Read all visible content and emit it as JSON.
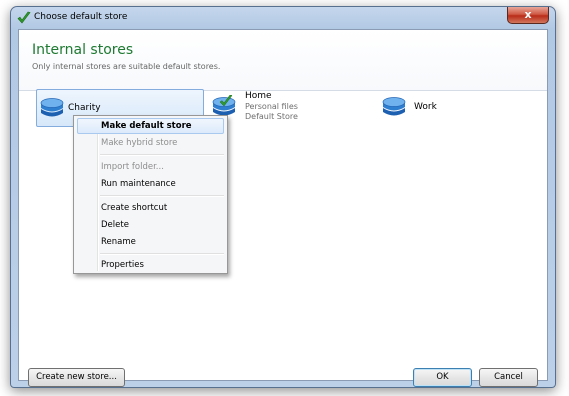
{
  "window": {
    "title": "Choose default store",
    "close_label": "x"
  },
  "header": {
    "title": "Internal stores",
    "subtitle": "Only internal stores are suitable default stores."
  },
  "stores": [
    {
      "name": "Charity",
      "lines": []
    },
    {
      "name": "Home",
      "lines": [
        "Personal files",
        "Default Store"
      ]
    },
    {
      "name": "Work",
      "lines": []
    }
  ],
  "context_menu": {
    "items": [
      {
        "label": "Make default store",
        "state": "highlighted-bold"
      },
      {
        "label": "Make hybrid store",
        "state": "disabled"
      },
      {
        "label": "Import folder...",
        "state": "disabled"
      },
      {
        "label": "Run maintenance",
        "state": "enabled"
      },
      {
        "label": "Create shortcut",
        "state": "enabled"
      },
      {
        "label": "Delete",
        "state": "enabled"
      },
      {
        "label": "Rename",
        "state": "enabled"
      },
      {
        "label": "Properties",
        "state": "enabled"
      }
    ]
  },
  "footer": {
    "create_label": "Create new store...",
    "ok_label": "OK",
    "cancel_label": "Cancel"
  },
  "colors": {
    "header_title": "#1e7a31",
    "icon_blue": "#2f7fd0",
    "check_green": "#2e9a2b"
  },
  "icons": {
    "title": "green-checkmark-icon",
    "store": "store-stack-icon",
    "default_badge": "green-checkmark-icon"
  }
}
